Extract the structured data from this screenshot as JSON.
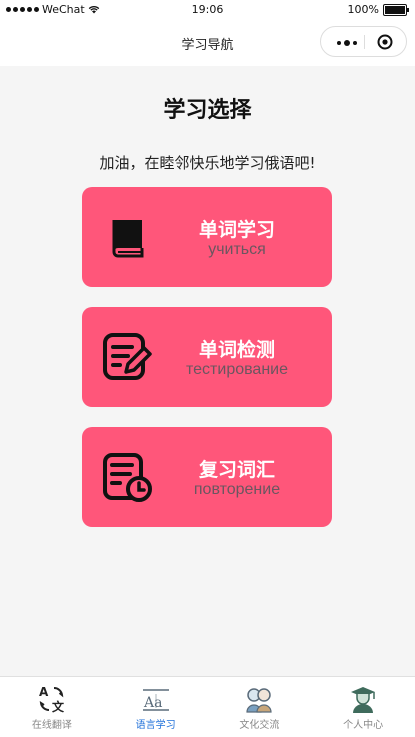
{
  "status_bar": {
    "carrier": "WeChat",
    "time": "19:06",
    "battery": "100%"
  },
  "nav": {
    "title": "学习导航"
  },
  "page": {
    "title": "学习选择",
    "subtitle": "加油，在睦邻快乐地学习俄语吧!"
  },
  "cards": [
    {
      "label": "单词学习",
      "sub": "учиться",
      "icon": "book-icon"
    },
    {
      "label": "单词检测",
      "sub": "тестирование",
      "icon": "edit-note-icon"
    },
    {
      "label": "复习词汇",
      "sub": "повторение",
      "icon": "clock-document-icon"
    }
  ],
  "tabbar": {
    "active_color": "#1e6fd9",
    "items": [
      {
        "label": "在线翻译",
        "icon": "translate-icon",
        "active": false
      },
      {
        "label": "语言学习",
        "icon": "text-style-icon",
        "active": true
      },
      {
        "label": "文化交流",
        "icon": "people-chat-icon",
        "active": false
      },
      {
        "label": "个人中心",
        "icon": "graduate-icon",
        "active": false
      }
    ]
  },
  "colors": {
    "card": "#ff567a",
    "background": "#f5f5f5"
  }
}
